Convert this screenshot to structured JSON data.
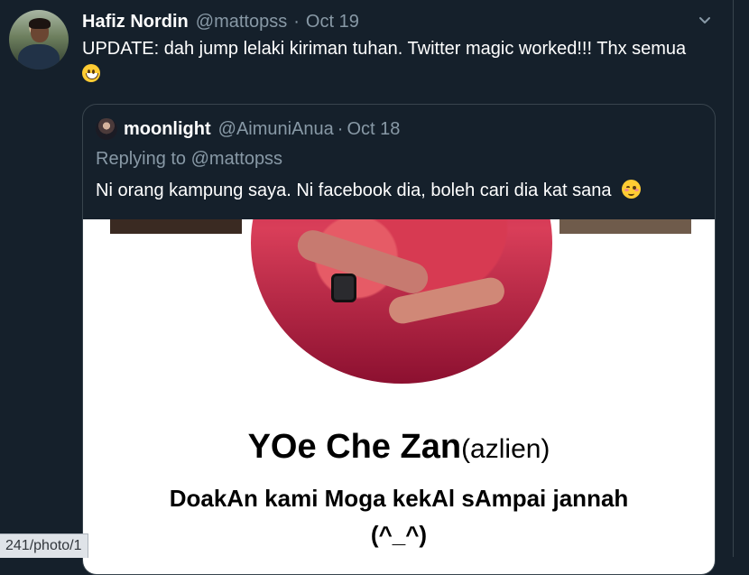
{
  "tweet": {
    "author_name": "Hafiz Nordin",
    "author_handle": "@mattopss",
    "separator": "·",
    "date": "Oct 19",
    "text": "UPDATE: dah jump lelaki kiriman tuhan. Twitter magic worked!!! Thx semua",
    "emoji": "grinning-face-icon"
  },
  "quote": {
    "author_name": "moonlight",
    "author_handle": "@AimuniAnua",
    "separator": "·",
    "date": "Oct 18",
    "replying_to": "Replying to @mattopss",
    "text": "Ni orang kampung saya. Ni facebook dia, boleh cari dia kat sana",
    "emoji": "smiling-face-with-smiling-eyes-icon",
    "image": {
      "name_main": "YOe Che Zan",
      "name_alt": "(azlien)",
      "bio_line1": "DoakAn kami Moga kekAl sAmpai jannah",
      "bio_line2": "(^_^)"
    }
  },
  "status_bar": {
    "url": "241/photo/1"
  },
  "colors": {
    "background": "#15202b",
    "secondary_text": "#8899a6",
    "border": "#38444d",
    "primary_text": "#ffffff"
  }
}
